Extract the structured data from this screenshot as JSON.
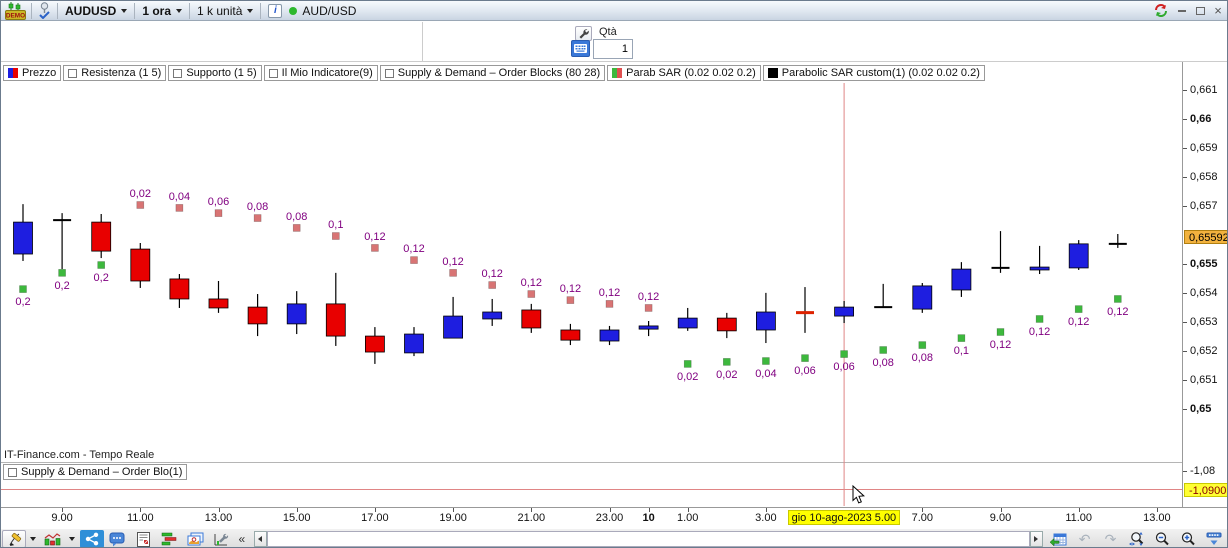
{
  "title_bar": {
    "demo_label": "DEMO",
    "symbol": "AUDUSD",
    "timeframe": "1 ora",
    "units": "1 k unità",
    "info_label": "i",
    "instrument": "AUD/USD"
  },
  "order_panel": {
    "qty_label": "Qtà",
    "qty_value": "1"
  },
  "legend_main": [
    {
      "icon": "price-series-icon",
      "label": "Prezzo"
    },
    {
      "icon": "checkbox",
      "label": "Resistenza (1 5)"
    },
    {
      "icon": "checkbox",
      "label": "Supporto (1 5)"
    },
    {
      "icon": "checkbox",
      "label": "Il Mio Indicatore(9)"
    },
    {
      "icon": "checkbox",
      "label": "Supply & Demand – Order Blocks (80 28)"
    },
    {
      "icon": "sar-series-icon",
      "label": "Parab SAR (0.02 0.02 0.2)"
    },
    {
      "icon": "black-series-icon",
      "label": "Parabolic SAR custom(1) (0.02 0.02 0.2)"
    }
  ],
  "legend_lower": [
    {
      "icon": "checkbox",
      "label": "Supply & Demand – Order Blo(1)"
    }
  ],
  "watermark": "IT-Finance.com - Tempo Reale",
  "collapse_label": "«",
  "toolbar_icons": [
    "draw-tool-icon",
    "draw-tool-dropdown",
    "chart-type-icon",
    "chart-type-dropdown",
    "share-icon",
    "comments-icon",
    "news-icon",
    "indicators-icon",
    "screenshots-icon",
    "chart-settings-icon",
    "collapse-icon",
    "scroll-left-icon",
    "scroll-right-icon",
    "goto-date-icon",
    "undo-icon",
    "redo-icon",
    "zoom-interval-icon",
    "zoom-out-icon",
    "zoom-in-icon",
    "display-options-icon"
  ],
  "colors": {
    "up": "#1e1ee0",
    "down": "#e80000",
    "doji": "#000000",
    "doji_red": "#dd2200",
    "sar_up": "#3db83d",
    "sar_down": "#d87474",
    "sar_label": "#800080",
    "crosshair": "#e08585",
    "price_marker_bg": "#f2b23e",
    "value_marker_bg": "#ffff33",
    "date_marker_bg": "#ffff00"
  },
  "chart_data": {
    "type": "candlestick",
    "symbol": "AUD/USD",
    "timeframe": "1 ora",
    "candles": [
      {
        "i": 0,
        "dir": "up",
        "o": 0.65531,
        "h": 0.65703,
        "l": 0.65507,
        "c": 0.65641
      },
      {
        "i": 1,
        "dir": "doji",
        "o": 0.65648,
        "h": 0.65672,
        "l": 0.65479,
        "c": 0.65648
      },
      {
        "i": 2,
        "dir": "down",
        "o": 0.65641,
        "h": 0.65669,
        "l": 0.65517,
        "c": 0.65541
      },
      {
        "i": 3,
        "dir": "down",
        "o": 0.65548,
        "h": 0.65569,
        "l": 0.65414,
        "c": 0.65438
      },
      {
        "i": 4,
        "dir": "down",
        "o": 0.65445,
        "h": 0.65462,
        "l": 0.65345,
        "c": 0.65376
      },
      {
        "i": 5,
        "dir": "down",
        "o": 0.65376,
        "h": 0.65438,
        "l": 0.65328,
        "c": 0.65345
      },
      {
        "i": 6,
        "dir": "down",
        "o": 0.65348,
        "h": 0.65393,
        "l": 0.65248,
        "c": 0.6529
      },
      {
        "i": 7,
        "dir": "up",
        "o": 0.6529,
        "h": 0.65403,
        "l": 0.65255,
        "c": 0.65359
      },
      {
        "i": 8,
        "dir": "down",
        "o": 0.65359,
        "h": 0.65466,
        "l": 0.65214,
        "c": 0.65248
      },
      {
        "i": 9,
        "dir": "down",
        "o": 0.65248,
        "h": 0.65279,
        "l": 0.65152,
        "c": 0.65193
      },
      {
        "i": 10,
        "dir": "up",
        "o": 0.6519,
        "h": 0.65279,
        "l": 0.65179,
        "c": 0.65255
      },
      {
        "i": 11,
        "dir": "up",
        "o": 0.65241,
        "h": 0.65383,
        "l": 0.65241,
        "c": 0.65317
      },
      {
        "i": 12,
        "dir": "up",
        "o": 0.65307,
        "h": 0.65376,
        "l": 0.65283,
        "c": 0.65331
      },
      {
        "i": 13,
        "dir": "down",
        "o": 0.65338,
        "h": 0.65359,
        "l": 0.65259,
        "c": 0.65276
      },
      {
        "i": 14,
        "dir": "down",
        "o": 0.65269,
        "h": 0.6529,
        "l": 0.65217,
        "c": 0.65234
      },
      {
        "i": 15,
        "dir": "up",
        "o": 0.65231,
        "h": 0.65283,
        "l": 0.65217,
        "c": 0.65269
      },
      {
        "i": 16,
        "dir": "up",
        "o": 0.65272,
        "h": 0.653,
        "l": 0.65248,
        "c": 0.65283
      },
      {
        "i": 17,
        "dir": "up",
        "o": 0.65276,
        "h": 0.65345,
        "l": 0.65266,
        "c": 0.6531
      },
      {
        "i": 18,
        "dir": "down",
        "o": 0.6531,
        "h": 0.65328,
        "l": 0.65241,
        "c": 0.65266
      },
      {
        "i": 19,
        "dir": "up",
        "o": 0.65269,
        "h": 0.65397,
        "l": 0.65224,
        "c": 0.65331
      },
      {
        "i": 20,
        "dir": "doji_red",
        "o": 0.65334,
        "h": 0.65417,
        "l": 0.65259,
        "c": 0.65324
      },
      {
        "i": 21,
        "dir": "up",
        "o": 0.65317,
        "h": 0.65369,
        "l": 0.65293,
        "c": 0.65348
      },
      {
        "i": 22,
        "dir": "doji",
        "o": 0.65348,
        "h": 0.65428,
        "l": 0.65345,
        "c": 0.65348
      },
      {
        "i": 23,
        "dir": "up",
        "o": 0.65341,
        "h": 0.65431,
        "l": 0.65328,
        "c": 0.65421
      },
      {
        "i": 24,
        "dir": "up",
        "o": 0.65407,
        "h": 0.65503,
        "l": 0.65383,
        "c": 0.65479
      },
      {
        "i": 25,
        "dir": "doji",
        "o": 0.65483,
        "h": 0.6561,
        "l": 0.65466,
        "c": 0.65483
      },
      {
        "i": 26,
        "dir": "up",
        "o": 0.65476,
        "h": 0.65559,
        "l": 0.65462,
        "c": 0.65486
      },
      {
        "i": 27,
        "dir": "up",
        "o": 0.65483,
        "h": 0.65579,
        "l": 0.65476,
        "c": 0.65566
      },
      {
        "i": 28,
        "dir": "doji",
        "o": 0.65566,
        "h": 0.656,
        "l": 0.65552,
        "c": 0.65566
      }
    ],
    "sar_up_prev": [
      {
        "i": 0,
        "v": 0.6541,
        "label": "0,2"
      },
      {
        "i": 1,
        "v": 0.65466,
        "label": "0,2"
      },
      {
        "i": 2,
        "v": 0.65493,
        "label": "0,2"
      }
    ],
    "sar_down": [
      {
        "i": 3,
        "v": 0.657,
        "label": "0,02"
      },
      {
        "i": 4,
        "v": 0.6569,
        "label": "0,04"
      },
      {
        "i": 5,
        "v": 0.65672,
        "label": "0,06"
      },
      {
        "i": 6,
        "v": 0.65655,
        "label": "0,08"
      },
      {
        "i": 7,
        "v": 0.65621,
        "label": "0,08"
      },
      {
        "i": 8,
        "v": 0.65593,
        "label": "0,1"
      },
      {
        "i": 9,
        "v": 0.65552,
        "label": "0,12"
      },
      {
        "i": 10,
        "v": 0.6551,
        "label": "0,12"
      },
      {
        "i": 11,
        "v": 0.65466,
        "label": "0,12"
      },
      {
        "i": 12,
        "v": 0.65424,
        "label": "0,12"
      },
      {
        "i": 13,
        "v": 0.65393,
        "label": "0,12"
      },
      {
        "i": 14,
        "v": 0.65372,
        "label": "0,12"
      },
      {
        "i": 15,
        "v": 0.65359,
        "label": "0,12"
      },
      {
        "i": 16,
        "v": 0.65345,
        "label": "0,12"
      }
    ],
    "sar_up": [
      {
        "i": 17,
        "v": 0.65152,
        "label": "0,02"
      },
      {
        "i": 18,
        "v": 0.65159,
        "label": "0,02"
      },
      {
        "i": 19,
        "v": 0.65162,
        "label": "0,04"
      },
      {
        "i": 20,
        "v": 0.65172,
        "label": "0,06"
      },
      {
        "i": 21,
        "v": 0.65186,
        "label": "0,06"
      },
      {
        "i": 22,
        "v": 0.652,
        "label": "0,08"
      },
      {
        "i": 23,
        "v": 0.65217,
        "label": "0,08"
      },
      {
        "i": 24,
        "v": 0.65241,
        "label": "0,1"
      },
      {
        "i": 25,
        "v": 0.65262,
        "label": "0,12"
      },
      {
        "i": 26,
        "v": 0.65307,
        "label": "0,12"
      },
      {
        "i": 27,
        "v": 0.65341,
        "label": "0,12"
      },
      {
        "i": 28,
        "v": 0.65376,
        "label": "0,12"
      }
    ],
    "y_axis": {
      "ticks": [
        {
          "label": "0,661",
          "v": 0.661,
          "bold": false
        },
        {
          "label": "0,66",
          "v": 0.66,
          "bold": true
        },
        {
          "label": "0,659",
          "v": 0.659,
          "bold": false
        },
        {
          "label": "0,658",
          "v": 0.658,
          "bold": false
        },
        {
          "label": "0,657",
          "v": 0.657,
          "bold": false
        },
        {
          "label": "0,655",
          "v": 0.655,
          "bold": true
        },
        {
          "label": "0,654",
          "v": 0.654,
          "bold": false
        },
        {
          "label": "0,653",
          "v": 0.653,
          "bold": false
        },
        {
          "label": "0,652",
          "v": 0.652,
          "bold": false
        },
        {
          "label": "0,651",
          "v": 0.651,
          "bold": false
        },
        {
          "label": "0,65",
          "v": 0.65,
          "bold": true
        }
      ],
      "last_price": {
        "label": "0,65592",
        "v": 0.65592
      }
    },
    "x_axis": {
      "ticks": [
        {
          "label": "9.00",
          "i": 1,
          "bold": false
        },
        {
          "label": "11.00",
          "i": 3,
          "bold": false
        },
        {
          "label": "13.00",
          "i": 5,
          "bold": false
        },
        {
          "label": "15.00",
          "i": 7,
          "bold": false
        },
        {
          "label": "17.00",
          "i": 9,
          "bold": false
        },
        {
          "label": "19.00",
          "i": 11,
          "bold": false
        },
        {
          "label": "21.00",
          "i": 13,
          "bold": false
        },
        {
          "label": "23.00",
          "i": 15,
          "bold": false
        },
        {
          "label": "10",
          "i": 16,
          "bold": true
        },
        {
          "label": "1.00",
          "i": 17,
          "bold": false
        },
        {
          "label": "3.00",
          "i": 19,
          "bold": false
        },
        {
          "label": "7.00",
          "i": 23,
          "bold": false
        },
        {
          "label": "9.00",
          "i": 25,
          "bold": false
        },
        {
          "label": "11.00",
          "i": 27,
          "bold": false
        },
        {
          "label": "13.00",
          "i": 29,
          "bold": false
        }
      ]
    },
    "crosshair": {
      "i": 21,
      "date_label": "gio 10-ago-2023 5.00",
      "value_label": "-1,0900"
    },
    "lower_panel": {
      "tick_label": "-1,08",
      "highlight_label": "-1,0900"
    },
    "ylim": [
      0.6466,
      0.6613
    ]
  }
}
